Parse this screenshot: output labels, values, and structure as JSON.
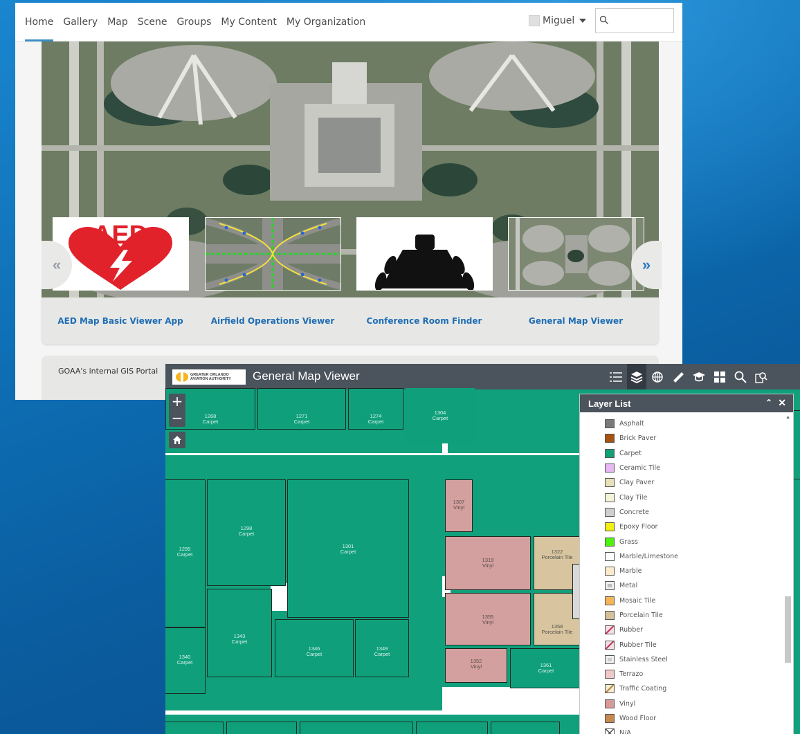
{
  "portal": {
    "nav": [
      "Home",
      "Gallery",
      "Map",
      "Scene",
      "Groups",
      "My Content",
      "My Organization"
    ],
    "user": "Miguel",
    "search_placeholder": "",
    "cards": [
      {
        "label": "AED Map Basic Viewer App"
      },
      {
        "label": "Airfield Operations Viewer"
      },
      {
        "label": "Conference Room Finder"
      },
      {
        "label": "General Map Viewer"
      }
    ],
    "aed_text": "AED",
    "arrow_left": "«",
    "arrow_right": "»",
    "description": "GOAA's internal GIS Portal"
  },
  "viewer": {
    "logo_text": "GREATER ORLANDO AVIATION AUTHORITY",
    "title": "General Map Viewer",
    "zoom_in": "+",
    "zoom_out": "−",
    "rooms": [
      {
        "num": "1268",
        "mat": "Carpet"
      },
      {
        "num": "1271",
        "mat": "Carpet"
      },
      {
        "num": "1274",
        "mat": "Carpet"
      },
      {
        "num": "1304",
        "mat": "Carpet"
      },
      {
        "num": "1298",
        "mat": "Carpet"
      },
      {
        "num": "1301",
        "mat": "Carpet"
      },
      {
        "num": "1295",
        "mat": "Carpet"
      },
      {
        "num": "1307",
        "mat": "Vinyl"
      },
      {
        "num": "1319",
        "mat": "Vinyl"
      },
      {
        "num": "1322",
        "mat": "Porcelain Tile"
      },
      {
        "num": "1343",
        "mat": "Carpet"
      },
      {
        "num": "1346",
        "mat": "Carpet"
      },
      {
        "num": "1349",
        "mat": "Carpet"
      },
      {
        "num": "1340",
        "mat": "Carpet"
      },
      {
        "num": "1355",
        "mat": "Vinyl"
      },
      {
        "num": "1358",
        "mat": "Porcelain Tile"
      },
      {
        "num": "1352",
        "mat": "Vinyl"
      },
      {
        "num": "1361",
        "mat": "Carpet"
      }
    ],
    "layer_list": {
      "title": "Layer List",
      "items": [
        {
          "label": "Asphalt",
          "color": "#7a7a7a"
        },
        {
          "label": "Brick Paver",
          "color": "#a8520f"
        },
        {
          "label": "Carpet",
          "color": "#12a079"
        },
        {
          "label": "Ceramic Tile",
          "color": "#e9b8f2"
        },
        {
          "label": "Clay Paver",
          "color": "#e8e2b8"
        },
        {
          "label": "Clay Tile",
          "color": "#f6f4d8"
        },
        {
          "label": "Concrete",
          "color": "#cfcfcf"
        },
        {
          "label": "Epoxy Floor",
          "color": "#f2ef12"
        },
        {
          "label": "Grass",
          "color": "#4ef20c"
        },
        {
          "label": "Marble/Limestone",
          "color": "#ffffff"
        },
        {
          "label": "Marble",
          "color": "#fdeacb"
        },
        {
          "label": "Metal",
          "color": "#bdbdbd"
        },
        {
          "label": "Mosaic Tile",
          "color": "#f5b45a"
        },
        {
          "label": "Porcelain Tile",
          "color": "#d5c09b"
        },
        {
          "label": "Rubber",
          "color": "#f3dfe5"
        },
        {
          "label": "Rubber Tile",
          "color": "#f3dfe5"
        },
        {
          "label": "Stainless Steel",
          "color": "#cdcdcd"
        },
        {
          "label": "Terrazo",
          "color": "#efc9c9"
        },
        {
          "label": "Traffic Coating",
          "color": "#f6ecd6"
        },
        {
          "label": "Vinyl",
          "color": "#d69a99"
        },
        {
          "label": "Wood Floor",
          "color": "#c78a4e"
        },
        {
          "label": "N/A",
          "color": "#ffffff"
        }
      ]
    }
  }
}
